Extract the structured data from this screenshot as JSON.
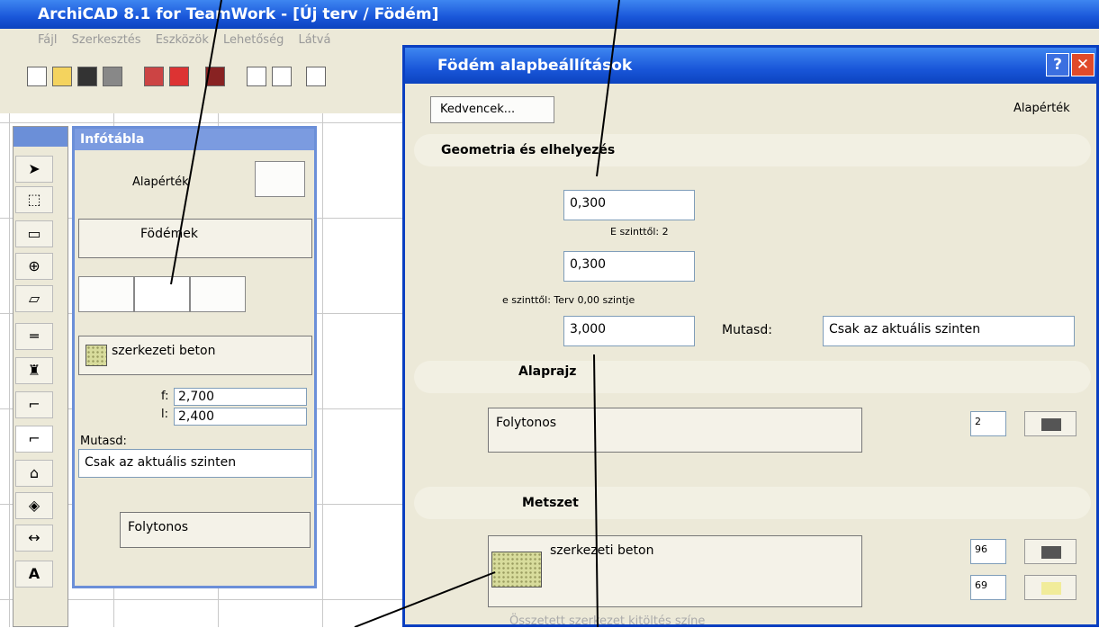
{
  "app": {
    "title": "ArchiCAD 8.1 for TeamWork - [Új terv / Födém]"
  },
  "menu": [
    "Fájl",
    "Szerkesztés",
    "Eszközök",
    "Lehetőség",
    "Látvá"
  ],
  "info": {
    "title": "Infótábla",
    "default_label": "Alapérték",
    "layer": "Födémek",
    "material": "szerkezeti beton",
    "f_label": "f:",
    "f_value": "2,700",
    "l_label": "l:",
    "l_value": "2,400",
    "show_label": "Mutasd:",
    "show_value": "Csak az aktuális szinten",
    "line": "Folytonos"
  },
  "dialog": {
    "title": "Födém alapbeállítások",
    "favorites": "Kedvencek...",
    "default_label": "Alapérték",
    "geometry": {
      "title": "Geometria és elhelyezés",
      "thickness": "0,300",
      "level_from_label": "E szinttől: 2",
      "offset": "0,300",
      "level_ref": "e szinttől: Terv 0,00 szintje",
      "height": "3,000",
      "show_label": "Mutasd:",
      "show_value": "Csak az aktuális szinten"
    },
    "plan": {
      "title": "Alaprajz",
      "line": "Folytonos",
      "pen": "2"
    },
    "section": {
      "title": "Metszet",
      "fill": "szerkezeti beton",
      "pen1": "96",
      "pen2": "69",
      "composite": "Összetett szerkezet kitöltés színe"
    }
  }
}
